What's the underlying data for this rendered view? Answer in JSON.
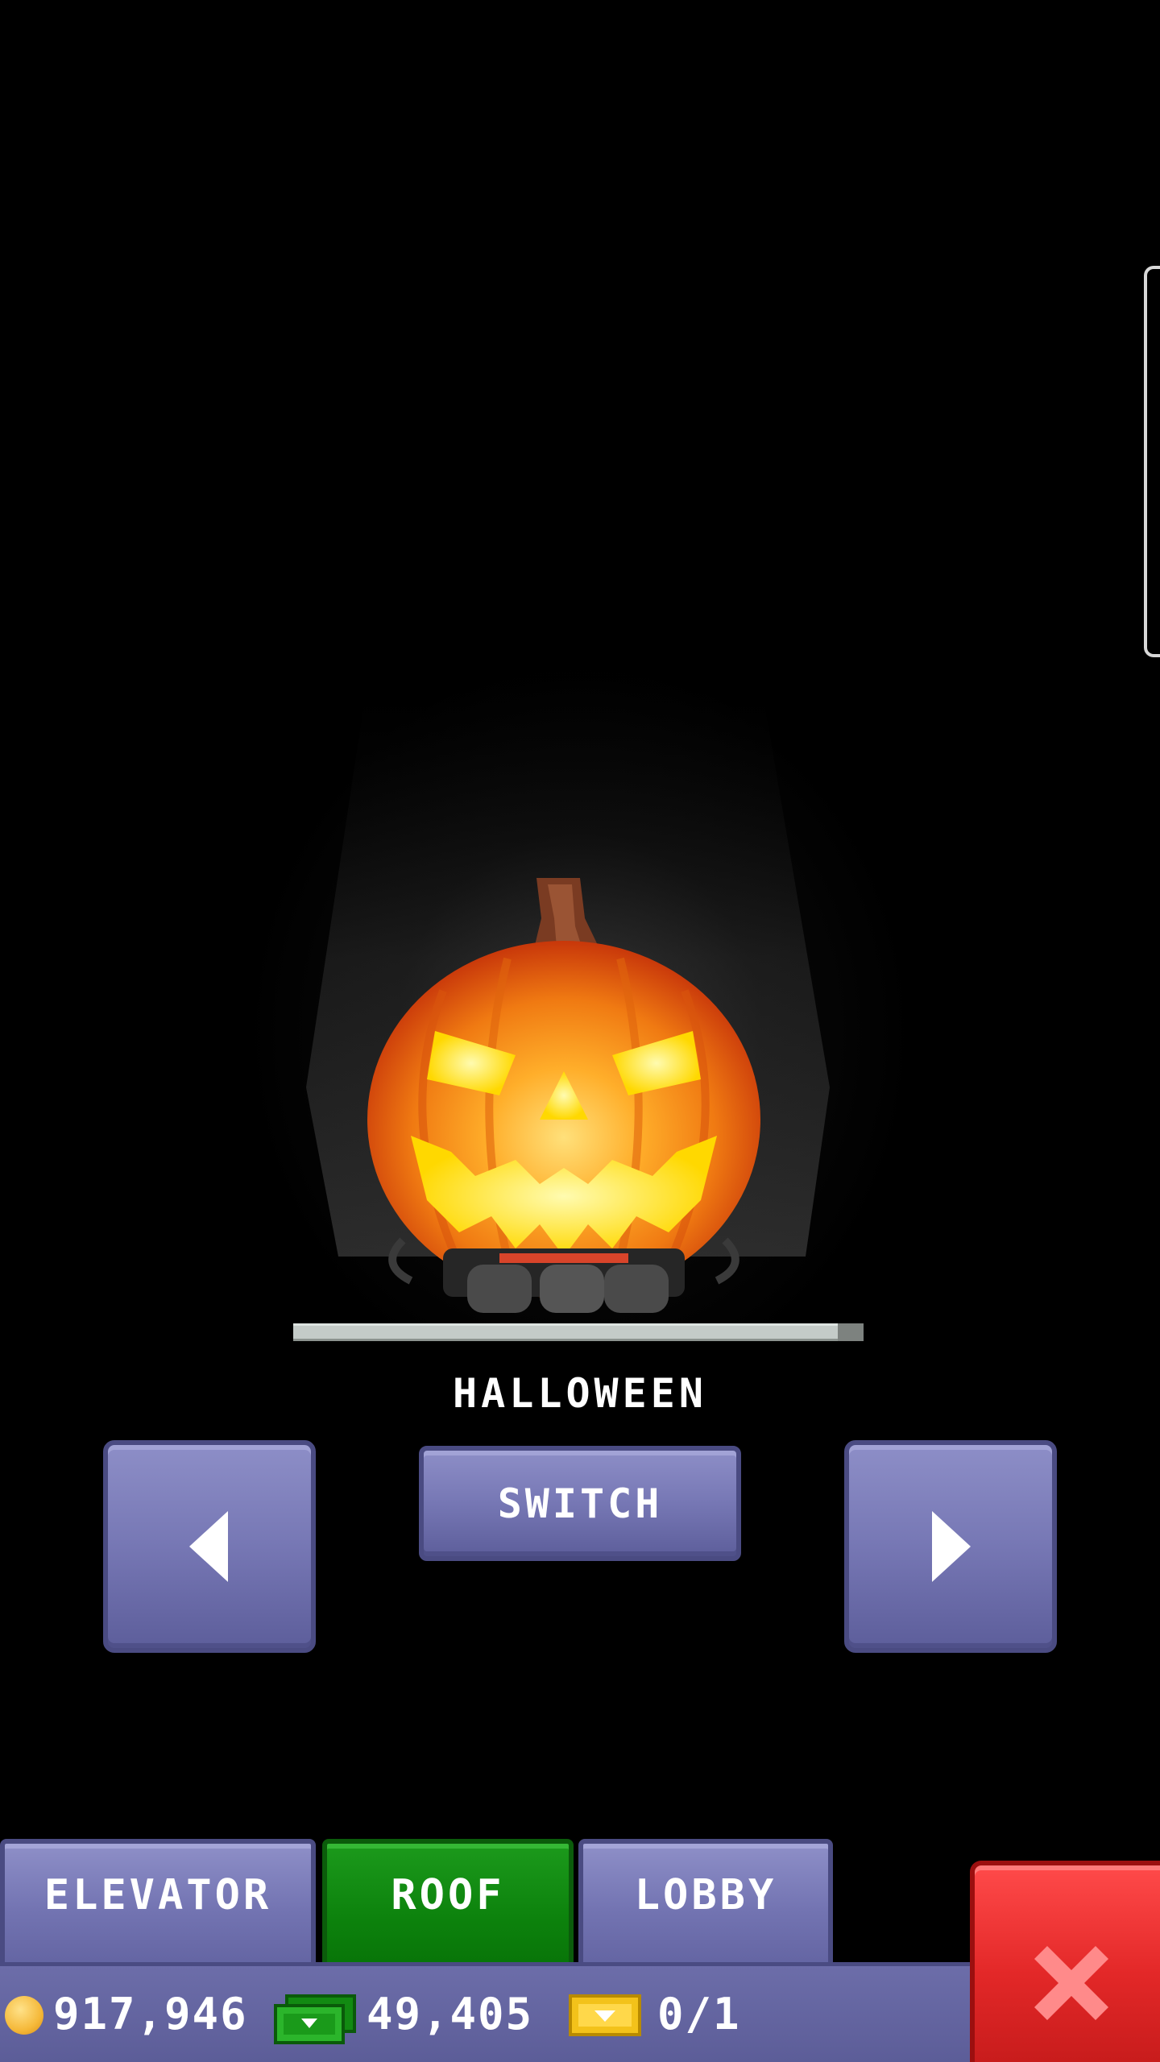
{
  "item": {
    "name": "HALLOWEEN",
    "icon": "jack-o-lantern"
  },
  "controls": {
    "prev_icon": "arrow-left",
    "next_icon": "arrow-right",
    "switch_label": "SWITCH"
  },
  "tabs": [
    {
      "label": "ELEVATOR",
      "active": false
    },
    {
      "label": "ROOF",
      "active": true
    },
    {
      "label": "LOBBY",
      "active": false
    }
  ],
  "status": {
    "coins": "917,946",
    "bux": "49,405",
    "tickets": "0/1"
  },
  "close_icon": "x-close",
  "colors": {
    "button_purple": "#7778b5",
    "tab_active_green": "#0d830d",
    "close_red": "#e32828",
    "background": "#000000"
  }
}
